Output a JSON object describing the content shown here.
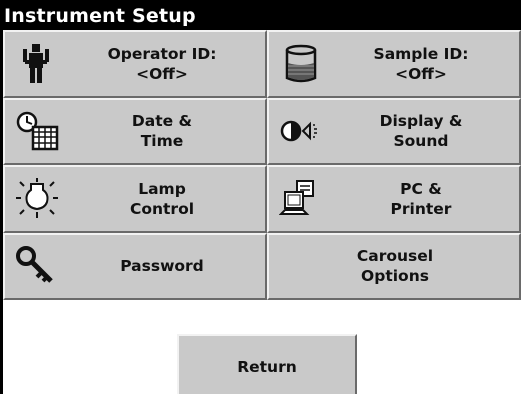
{
  "header": {
    "title": "Instrument Setup"
  },
  "buttons": [
    {
      "line1": "Operator ID:",
      "line2": "<Off>",
      "icon": "operator-icon"
    },
    {
      "line1": "Sample ID:",
      "line2": "<Off>",
      "icon": "sample-vial-icon"
    },
    {
      "line1": "Date &",
      "line2": "Time",
      "icon": "clock-calendar-icon"
    },
    {
      "line1": "Display &",
      "line2": "Sound",
      "icon": "display-sound-icon"
    },
    {
      "line1": "Lamp",
      "line2": "Control",
      "icon": "lamp-icon"
    },
    {
      "line1": "PC &",
      "line2": "Printer",
      "icon": "pc-printer-icon"
    },
    {
      "line1": "Password",
      "line2": "",
      "icon": "key-icon"
    },
    {
      "line1": "Carousel",
      "line2": "Options",
      "icon": ""
    }
  ],
  "footer": {
    "return_label": "Return"
  }
}
